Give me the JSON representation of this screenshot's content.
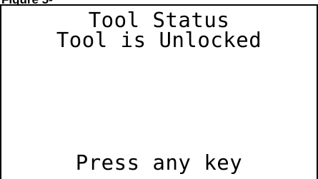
{
  "caption": "Figure 5-",
  "display": {
    "title": "Tool Status",
    "status": "Tool is Unlocked",
    "prompt": "Press any key"
  }
}
